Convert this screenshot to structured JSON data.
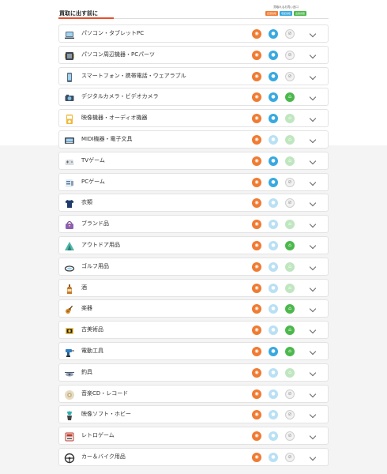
{
  "page": {
    "title": "買取に出す前に"
  },
  "legend": {
    "title": "買取れるお買い言口",
    "items": [
      {
        "label": "店頭買取",
        "color": "#f07b32"
      },
      {
        "label": "宅配買取",
        "color": "#38a9e0"
      },
      {
        "label": "出張買取",
        "color": "#4cb84c"
      }
    ]
  },
  "colors": {
    "store": "#f07b32",
    "delivery": "#38a9e0",
    "visit": "#4cb84c",
    "accent": "#e84e2a",
    "band": "#f4f4f4"
  },
  "categories": [
    {
      "label": "パソコン・タブレットPC",
      "icon": "laptop-icon",
      "store": "on",
      "delivery": "on",
      "visit": "na"
    },
    {
      "label": "パソコン周辺機器・PCパーツ",
      "icon": "pc-parts-icon",
      "store": "on",
      "delivery": "on",
      "visit": "na"
    },
    {
      "label": "スマートフォン・携帯電話・ウェアラブル",
      "icon": "smartphone-icon",
      "store": "on",
      "delivery": "on",
      "visit": "na"
    },
    {
      "label": "デジタルカメラ・ビデオカメラ",
      "icon": "camera-icon",
      "store": "on",
      "delivery": "on",
      "visit": "on"
    },
    {
      "label": "映像機器・オーディオ機器",
      "icon": "audio-player-icon",
      "store": "on",
      "delivery": "on",
      "visit": "off"
    },
    {
      "label": "MIDI機器・電子文具",
      "icon": "midi-device-icon",
      "store": "on",
      "delivery": "off",
      "visit": "off"
    },
    {
      "label": "TVゲーム",
      "icon": "game-controller-icon",
      "store": "on",
      "delivery": "on",
      "visit": "off"
    },
    {
      "label": "PCゲーム",
      "icon": "pc-game-icon",
      "store": "on",
      "delivery": "on",
      "visit": "na"
    },
    {
      "label": "衣類",
      "icon": "tshirt-icon",
      "store": "on",
      "delivery": "off",
      "visit": "na"
    },
    {
      "label": "ブランド品",
      "icon": "handbag-icon",
      "store": "on",
      "delivery": "off",
      "visit": "off"
    },
    {
      "label": "アウトドア用品",
      "icon": "tent-icon",
      "store": "on",
      "delivery": "off",
      "visit": "on"
    },
    {
      "label": "ゴルフ用品",
      "icon": "golf-club-icon",
      "store": "on",
      "delivery": "off",
      "visit": "off"
    },
    {
      "label": "酒",
      "icon": "sake-bottle-icon",
      "store": "on",
      "delivery": "off",
      "visit": "off"
    },
    {
      "label": "楽器",
      "icon": "guitar-icon",
      "store": "on",
      "delivery": "off",
      "visit": "on"
    },
    {
      "label": "古美術品",
      "icon": "antique-icon",
      "store": "on",
      "delivery": "off",
      "visit": "on"
    },
    {
      "label": "電動工具",
      "icon": "power-drill-icon",
      "store": "on",
      "delivery": "on",
      "visit": "on"
    },
    {
      "label": "釣具",
      "icon": "fishing-reel-icon",
      "store": "on",
      "delivery": "off",
      "visit": "off"
    },
    {
      "label": "音楽CD・レコード",
      "icon": "cd-icon",
      "store": "on",
      "delivery": "off",
      "visit": "na"
    },
    {
      "label": "映像ソフト・ホビー",
      "icon": "figure-icon",
      "store": "on",
      "delivery": "off",
      "visit": "na"
    },
    {
      "label": "レトロゲーム",
      "icon": "retro-console-icon",
      "store": "on",
      "delivery": "off",
      "visit": "na"
    },
    {
      "label": "カー＆バイク用品",
      "icon": "steering-wheel-icon",
      "store": "on",
      "delivery": "off",
      "visit": "na"
    }
  ]
}
